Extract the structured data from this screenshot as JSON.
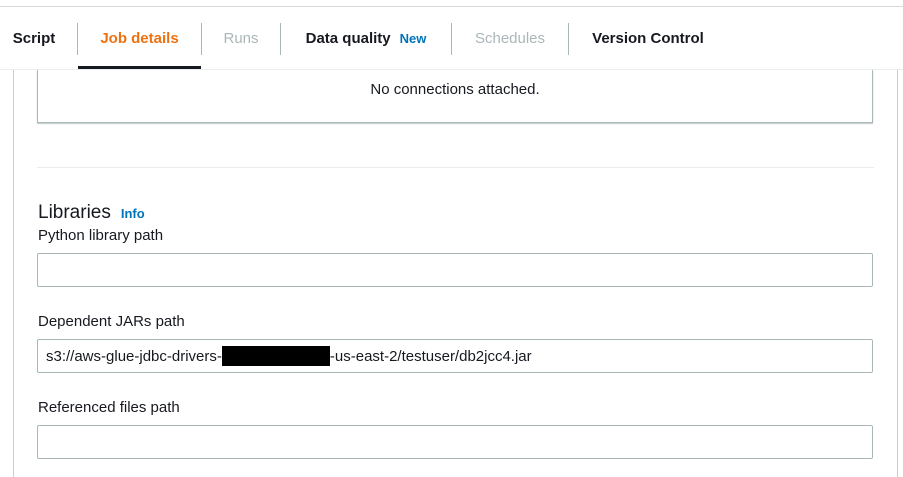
{
  "tabs": [
    {
      "label": "Script",
      "state": "normal"
    },
    {
      "label": "Job details",
      "state": "active"
    },
    {
      "label": "Runs",
      "state": "disabled"
    },
    {
      "label": "Data quality",
      "state": "normal",
      "badge": "New"
    },
    {
      "label": "Schedules",
      "state": "disabled"
    },
    {
      "label": "Version Control",
      "state": "normal"
    }
  ],
  "connections": {
    "empty_text": "No connections attached."
  },
  "libraries": {
    "title": "Libraries",
    "info_link": "Info",
    "python_library_path": {
      "label": "Python library path",
      "value": ""
    },
    "dependent_jars_path": {
      "label": "Dependent JARs path",
      "value_prefix": "s3://aws-glue-jdbc-drivers-",
      "value_suffix": "-us-east-2/testuser/db2jcc4.jar",
      "redacted": true
    },
    "referenced_files_path": {
      "label": "Referenced files path",
      "value": ""
    }
  },
  "colors": {
    "active_tab": "#ec7211",
    "link": "#0073bb",
    "disabled_text": "#aab7b8",
    "border": "#aab7b8"
  }
}
